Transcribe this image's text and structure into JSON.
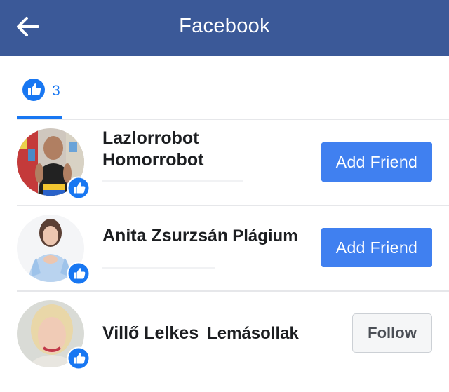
{
  "header": {
    "title": "Facebook",
    "background": "#3b5998",
    "back_icon": "arrow-left-icon"
  },
  "reactions_tab": {
    "icon": "like-thumb-icon",
    "count": "3",
    "accent": "#1877f2"
  },
  "people": [
    {
      "name_line1": "Lazlorrobot",
      "name_line2": "Homorrobot",
      "action_label": "Add Friend",
      "reaction_icon": "like-thumb-icon"
    },
    {
      "name": "Anita Zsurzsán",
      "name_suffix": "Plágium",
      "action_label": "Add Friend",
      "reaction_icon": "like-thumb-icon"
    },
    {
      "name": "Villő Lelkes",
      "name_suffix": "Lemásollak",
      "action_label": "Follow",
      "reaction_icon": "like-thumb-icon"
    }
  ],
  "colors": {
    "primary_button": "#4080f0",
    "secondary_button": "#f5f6f7"
  }
}
